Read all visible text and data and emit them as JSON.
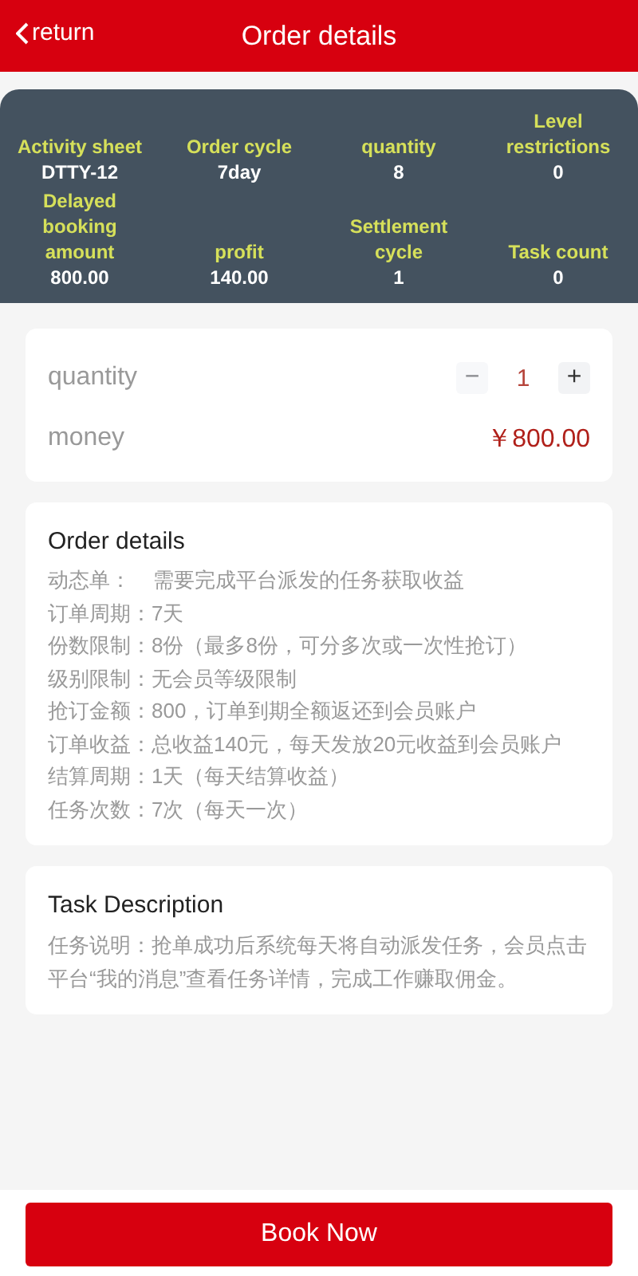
{
  "header": {
    "back_label": "return",
    "title": "Order details"
  },
  "stats": [
    {
      "label": "Activity sheet",
      "value": "DTTY-12"
    },
    {
      "label": "Order cycle",
      "value": "7day"
    },
    {
      "label": "quantity",
      "value": "8"
    },
    {
      "label": "Level restrictions",
      "value": "0"
    },
    {
      "label": "Delayed booking amount",
      "value": "800.00"
    },
    {
      "label": "profit",
      "value": "140.00"
    },
    {
      "label": "Settlement cycle",
      "value": "1"
    },
    {
      "label": "Task count",
      "value": "0"
    }
  ],
  "purchase": {
    "quantity_label": "quantity",
    "minus": "−",
    "minus_disabled": true,
    "quantity": "1",
    "plus": "+",
    "money_label": "money",
    "money": "￥800.00"
  },
  "order_details": {
    "title": "Order details",
    "lines": [
      {
        "label": "动态单：",
        "value": "需要完成平台派发的任务获取收益",
        "spaced": true
      },
      {
        "label": "订单周期：",
        "value": "7天",
        "spaced": false
      },
      {
        "label": "份数限制：",
        "value": "8份（最多8份，可分多次或一次性抢订）",
        "spaced": false
      },
      {
        "label": "级别限制：",
        "value": "无会员等级限制",
        "spaced": false
      },
      {
        "label": "抢订金额：",
        "value": "800，订单到期全额返还到会员账户",
        "spaced": false
      },
      {
        "label": "订单收益：",
        "value": "总收益140元，每天发放20元收益到会员账户",
        "spaced": false
      },
      {
        "label": "结算周期：",
        "value": "1天（每天结算收益）",
        "spaced": false
      },
      {
        "label": "任务次数：",
        "value": "7次（每天一次）",
        "spaced": false
      }
    ]
  },
  "task_description": {
    "title": "Task Description",
    "text": "任务说明：抢单成功后系统每天将自动派发任务，会员点击平台“我的消息”查看任务详情，完成工作赚取佣金。"
  },
  "book_button": "Book Now"
}
